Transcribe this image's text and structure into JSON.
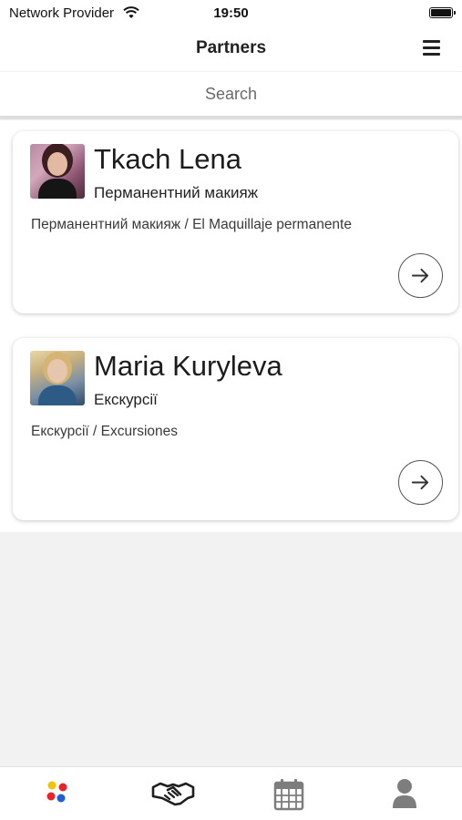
{
  "status_bar": {
    "carrier": "Network Provider",
    "time": "19:50"
  },
  "header": {
    "title": "Partners",
    "menu_icon": "hamburger-menu-icon"
  },
  "search": {
    "placeholder": "Search"
  },
  "partners": [
    {
      "name": "Tkach Lena",
      "category": "Перманентний макияж",
      "description": "Перманентний макияж / El Maquillaje permanente",
      "action_icon": "arrow-right-icon"
    },
    {
      "name": "Maria Kuryleva",
      "category": "Екскурсії",
      "description": "Екскурсії / Excursiones",
      "action_icon": "arrow-right-icon"
    }
  ],
  "tab_bar": {
    "tabs": [
      {
        "icon": "colored-dots-icon",
        "active": false
      },
      {
        "icon": "handshake-icon",
        "active": true
      },
      {
        "icon": "calendar-icon",
        "active": false
      },
      {
        "icon": "person-icon",
        "active": false
      }
    ]
  },
  "colors": {
    "dot_yellow": "#f5c400",
    "dot_red": "#e8242a",
    "dot_blue": "#1f5fd6",
    "tab_active": "#1e1e1e",
    "tab_inactive": "#7d7d7d"
  }
}
